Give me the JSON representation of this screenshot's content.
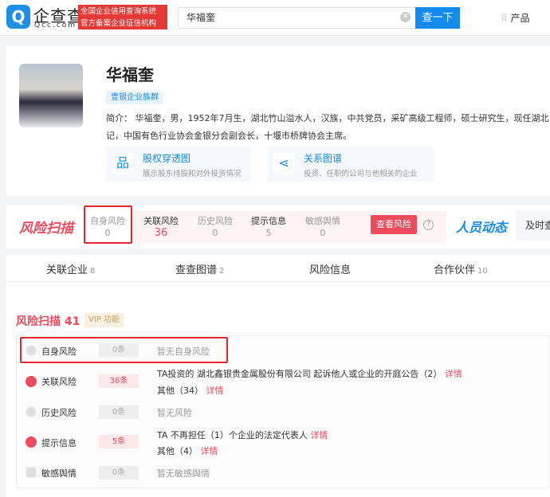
{
  "header": {
    "logo_text": "企查查",
    "logo_sub": "Qcc.com",
    "slogan_line1": "全国企业信用查询系统",
    "slogan_line2": "官方备案企业征信机构",
    "search_value": "华福奎",
    "search_button": "查一下",
    "products": "产品"
  },
  "profile": {
    "name": "华福奎",
    "tag": "壹银企业族群",
    "intro_line1": "简介： 华福奎，男，1952年7月生，湖北竹山溢水人，汉族，中共党员，采矿高级工程师，硕士研究生，现任湖北",
    "intro_line2": "记，中国有色行业协会金银分会副会长，十堰市桥牌协会主席。",
    "features": [
      {
        "title": "股权穿透图",
        "desc": "展示股东持股和对外投资情况"
      },
      {
        "title": "关系图谱",
        "desc": "投资、任职的公司与他相关的企业"
      }
    ]
  },
  "risk_bar": {
    "title": "风险扫描",
    "items": [
      {
        "label": "自身风险",
        "value": "0"
      },
      {
        "label": "关联风险",
        "value": "36"
      },
      {
        "label": "历史风险",
        "value": "0"
      },
      {
        "label": "提示信息",
        "value": "5"
      },
      {
        "label": "敏感舆情",
        "value": "0"
      }
    ],
    "view_button": "查看风险",
    "people_title": "人员动态",
    "people_box": "及时查"
  },
  "tabs": [
    {
      "label": "关联企业",
      "count": "8"
    },
    {
      "label": "查查图谱",
      "count": "2"
    },
    {
      "label": "风险信息",
      "count": ""
    },
    {
      "label": "合作伙伴",
      "count": "10"
    }
  ],
  "scan": {
    "title": "风险扫描 41",
    "vip": "VIP 功能",
    "rows": [
      {
        "label": "自身风险",
        "count": "0条",
        "line1": "暂无自身风险"
      },
      {
        "label": "关联风险",
        "count": "36条",
        "line1": "TA投资的 湖北鑫银贵金属股份有限公司 起诉他人或企业的开庭公告（2）",
        "link1": "详情",
        "line2": "其他（34）",
        "link2": "详情"
      },
      {
        "label": "历史风险",
        "count": "0条",
        "line1": "暂无风险"
      },
      {
        "label": "提示信息",
        "count": "5条",
        "line1": "TA 不再担任（1）个企业的法定代表人",
        "link1": "详情",
        "line2": "其他（4）",
        "link2": "详情"
      },
      {
        "label": "敏感舆情",
        "count": "0条",
        "line1": "暂无敏感舆情"
      }
    ]
  },
  "colors": {
    "brand_blue": "#128bed",
    "risk_red": "#f04a5d",
    "highlight": "#e5262b"
  }
}
